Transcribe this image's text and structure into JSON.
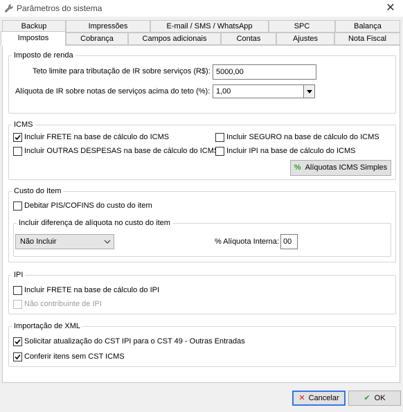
{
  "window": {
    "title": "Parâmetros do sistema"
  },
  "tabs": {
    "row_top": [
      "Backup",
      "Impressões",
      "E-mail / SMS / WhatsApp",
      "SPC",
      "Balança"
    ],
    "row_bottom": [
      "Impostos",
      "Cobrança",
      "Campos adicionais",
      "Contas",
      "Ajustes",
      "Nota Fiscal"
    ],
    "active": "Impostos"
  },
  "imposto_renda": {
    "title": "Imposto de renda",
    "teto_label": "Teto limite para tributação de IR sobre serviços (R$):",
    "teto_value": "5000,00",
    "aliquota_label": "Alíquota de IR sobre notas de serviços acima do teto (%):",
    "aliquota_value": "1,00"
  },
  "icms": {
    "title": "ICMS",
    "frete_label": "Incluir FRETE na base de cálculo do ICMS",
    "frete_checked": true,
    "seguro_label": "Incluir SEGURO na base de cálculo do ICMS",
    "seguro_checked": false,
    "outras_label": "Incluir OUTRAS DESPESAS na base de cálculo do ICMS",
    "outras_checked": false,
    "ipi_label": "Incluir IPI na base de cálculo do ICMS",
    "ipi_checked": false,
    "aliquotas_button": "Alíquotas ICMS Simples"
  },
  "custo_item": {
    "title": "Custo do Item",
    "debitar_label": "Debitar PIS/COFINS do custo do item",
    "debitar_checked": false,
    "diferenca": {
      "title": "Incluir diferença de alíquota no custo do item",
      "select_value": "Não Incluir",
      "aliquota_interna_label": "% Alíquota Interna:",
      "aliquota_interna_value": "00"
    }
  },
  "ipi": {
    "title": "IPI",
    "frete_label": "Incluir FRETE na base de cálculo do IPI",
    "frete_checked": false,
    "nao_contribuinte_label": "Não contribuinte de IPI",
    "nao_contribuinte_checked": false
  },
  "importacao_xml": {
    "title": "Importação de XML",
    "solicitar_label": "Solicitar atualização do CST IPI para o CST 49 - Outras Entradas",
    "solicitar_checked": true,
    "conferir_label": "Conferir itens sem CST ICMS",
    "conferir_checked": true
  },
  "footer": {
    "cancel": "Cancelar",
    "ok": "OK"
  },
  "colors": {
    "accent": "#3578e5",
    "cancel_x": "#e81123",
    "ok_check": "#2e9e32"
  }
}
